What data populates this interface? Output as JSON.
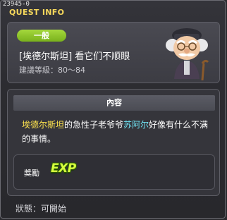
{
  "quest_id": "23945-0",
  "title": "QUEST INFO",
  "card": {
    "tag": "一般",
    "quest_name": "[埃德尔斯坦] 看它们不顺眼",
    "level": "建議等級：80～84"
  },
  "content": {
    "header": "內容",
    "desc_npc1": "埃德尔斯坦",
    "desc_mid": "的急性子老爷爷",
    "desc_npc2": "苏阿尔",
    "desc_end": "好像有什么不满的事情。"
  },
  "reward": {
    "label": "獎勵",
    "exp": "EXP"
  },
  "status": "狀態：可開始",
  "colors": {
    "title": "#f7d95c",
    "tag_green": "#8cc62a",
    "highlight_yellow": "#ffe44e",
    "highlight_cyan": "#6fe0f0",
    "exp_green": "#d6ff3e"
  },
  "icons": [
    "old-man-npc-icon"
  ]
}
